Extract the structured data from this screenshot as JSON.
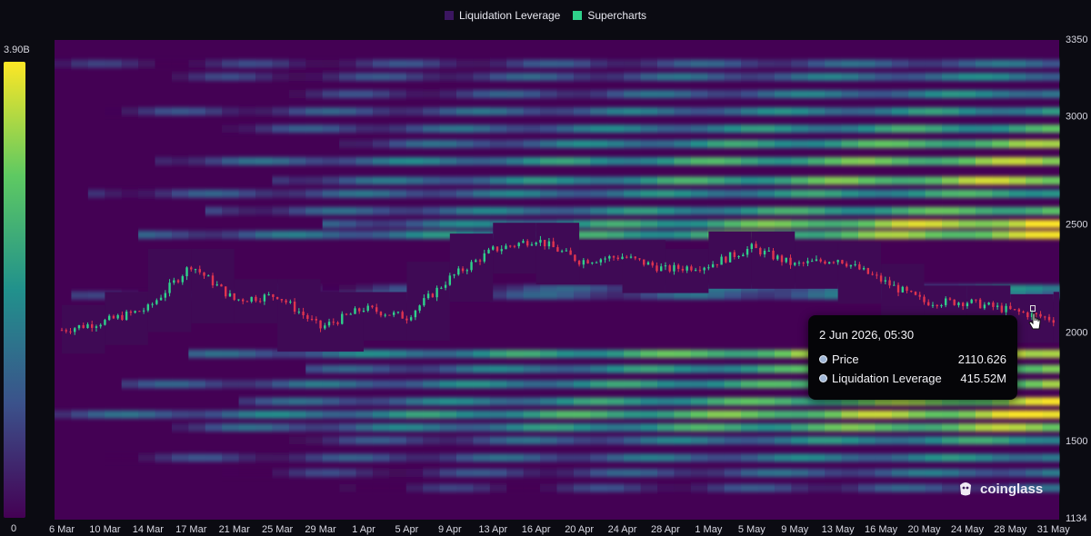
{
  "legend": {
    "items": [
      {
        "label": "Liquidation Leverage",
        "color": "#3b1660"
      },
      {
        "label": "Supercharts",
        "color": "#2fd18b"
      }
    ]
  },
  "colorbar": {
    "max_label": "3.90B",
    "min_label": "0",
    "colors": [
      "#440154",
      "#3b528b",
      "#21918c",
      "#5ec962",
      "#fde725"
    ]
  },
  "tooltip": {
    "title": "2 Jun 2026, 05:30",
    "rows": [
      {
        "label": "Price",
        "value": "2110.626"
      },
      {
        "label": "Liquidation Leverage",
        "value": "415.52M"
      }
    ]
  },
  "watermark": {
    "text": "coinglass",
    "icon": "coinglass-logo-icon"
  },
  "chart_data": {
    "type": "heatmap",
    "title": "",
    "y_axis_side": "right",
    "ylim": [
      1134,
      3350
    ],
    "y_ticks": [
      3350,
      3000,
      2500,
      2000,
      1500,
      1134
    ],
    "x_ticks": [
      "6 Mar",
      "10 Mar",
      "14 Mar",
      "17 Mar",
      "21 Mar",
      "25 Mar",
      "29 Mar",
      "1 Apr",
      "5 Apr",
      "9 Apr",
      "13 Apr",
      "16 Apr",
      "20 Apr",
      "24 Apr",
      "28 Apr",
      "1 May",
      "5 May",
      "9 May",
      "13 May",
      "16 May",
      "20 May",
      "24 May",
      "28 May",
      "31 May"
    ],
    "price_series": [
      {
        "date": "6 Mar",
        "close": 2010
      },
      {
        "date": "10 Mar",
        "close": 2050
      },
      {
        "date": "14 Mar",
        "close": 2110
      },
      {
        "date": "17 Mar",
        "close": 2310
      },
      {
        "date": "21 Mar",
        "close": 2150
      },
      {
        "date": "25 Mar",
        "close": 2170
      },
      {
        "date": "29 Mar",
        "close": 2020
      },
      {
        "date": "1 Apr",
        "close": 2110
      },
      {
        "date": "5 Apr",
        "close": 2070
      },
      {
        "date": "9 Apr",
        "close": 2250
      },
      {
        "date": "13 Apr",
        "close": 2380
      },
      {
        "date": "16 Apr",
        "close": 2430
      },
      {
        "date": "20 Apr",
        "close": 2330
      },
      {
        "date": "24 Apr",
        "close": 2350
      },
      {
        "date": "28 Apr",
        "close": 2290
      },
      {
        "date": "1 May",
        "close": 2310
      },
      {
        "date": "5 May",
        "close": 2390
      },
      {
        "date": "9 May",
        "close": 2310
      },
      {
        "date": "13 May",
        "close": 2340
      },
      {
        "date": "16 May",
        "close": 2240
      },
      {
        "date": "20 May",
        "close": 2140
      },
      {
        "date": "24 May",
        "close": 2140
      },
      {
        "date": "28 May",
        "close": 2100
      },
      {
        "date": "31 May",
        "close": 2060
      },
      {
        "date": "2 Jun",
        "close": 2110.626
      }
    ],
    "liquidation_bands": [
      {
        "price": 3240,
        "intensity": 0.3
      },
      {
        "price": 3180,
        "intensity": 0.4
      },
      {
        "price": 3100,
        "intensity": 0.45
      },
      {
        "price": 3020,
        "intensity": 0.5
      },
      {
        "price": 2940,
        "intensity": 0.6
      },
      {
        "price": 2870,
        "intensity": 0.75
      },
      {
        "price": 2790,
        "intensity": 0.8
      },
      {
        "price": 2700,
        "intensity": 0.85
      },
      {
        "price": 2640,
        "intensity": 0.6
      },
      {
        "price": 2560,
        "intensity": 0.7
      },
      {
        "price": 2500,
        "intensity": 0.95
      },
      {
        "price": 2450,
        "intensity": 0.85
      },
      {
        "price": 2200,
        "intensity": 0.4
      },
      {
        "price": 2170,
        "intensity": 0.35
      },
      {
        "price": 1900,
        "intensity": 0.95
      },
      {
        "price": 1830,
        "intensity": 0.8
      },
      {
        "price": 1760,
        "intensity": 0.75
      },
      {
        "price": 1680,
        "intensity": 0.85
      },
      {
        "price": 1620,
        "intensity": 0.9
      },
      {
        "price": 1560,
        "intensity": 0.8
      },
      {
        "price": 1500,
        "intensity": 0.55
      },
      {
        "price": 1420,
        "intensity": 0.45
      },
      {
        "price": 1350,
        "intensity": 0.35
      },
      {
        "price": 1280,
        "intensity": 0.25
      }
    ]
  }
}
